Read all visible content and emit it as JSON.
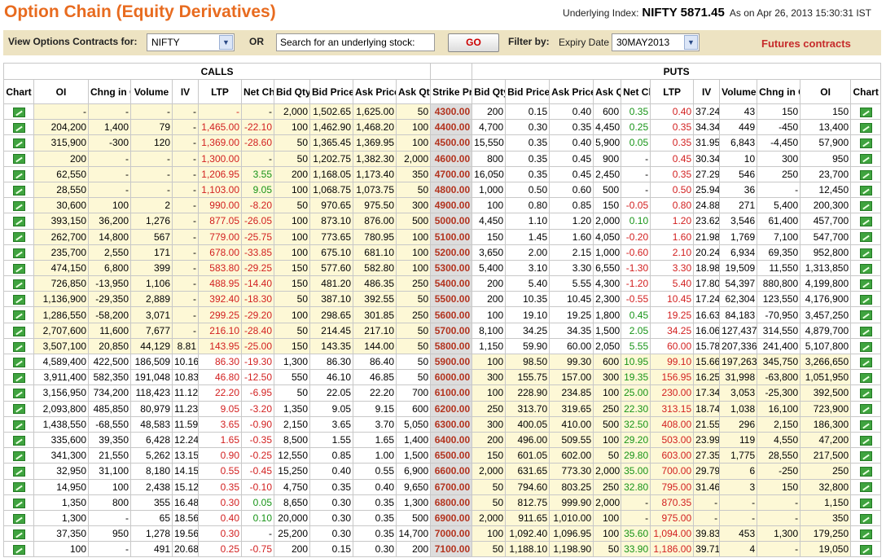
{
  "header": {
    "title": "Option Chain (Equity Derivatives)",
    "underlying_label": "Underlying Index:",
    "underlying_value": "NIFTY 5871.45",
    "as_on": "As on Apr 26, 2013 15:30:31 IST"
  },
  "filter": {
    "view_label": "View Options Contracts for:",
    "instrument": "NIFTY",
    "or_label": "OR",
    "search_value": "Search for an underlying stock:",
    "go_label": "GO",
    "filter_by_label": "Filter by:",
    "expiry_label": "Expiry Date",
    "expiry_value": "30MAY2013",
    "futures_link": "Futures contracts"
  },
  "table": {
    "calls_label": "CALLS",
    "puts_label": "PUTS",
    "columns": [
      "Chart",
      "OI",
      "Chng in OI",
      "Volume",
      "IV",
      "LTP",
      "Net Chng",
      "Bid Qty",
      "Bid Price",
      "Ask Price",
      "Ask Qty",
      "Strike Price",
      "Bid Qty",
      "Bid Price",
      "Ask Price",
      "Ask Qty",
      "Net Chng",
      "LTP",
      "IV",
      "Volume",
      "Chng in OI",
      "OI",
      "Chart"
    ],
    "rows": [
      [
        "",
        "-",
        "-",
        "-",
        "-",
        "-",
        "-",
        "2,000",
        "1,502.65",
        "1,625.00",
        "50",
        "4300.00",
        "200",
        "0.15",
        "0.40",
        "600",
        "0.35",
        "0.40",
        "37.24",
        "43",
        "150",
        "150",
        ""
      ],
      [
        "",
        "204,200",
        "1,400",
        "79",
        "-",
        "1,465.00",
        "-22.10",
        "100",
        "1,462.90",
        "1,468.20",
        "100",
        "4400.00",
        "4,700",
        "0.30",
        "0.35",
        "4,450",
        "0.25",
        "0.35",
        "34.34",
        "449",
        "-450",
        "13,400",
        ""
      ],
      [
        "",
        "315,900",
        "-300",
        "120",
        "-",
        "1,369.00",
        "-28.60",
        "50",
        "1,365.45",
        "1,369.95",
        "100",
        "4500.00",
        "15,550",
        "0.35",
        "0.40",
        "5,900",
        "0.05",
        "0.35",
        "31.95",
        "6,843",
        "-4,450",
        "57,900",
        ""
      ],
      [
        "",
        "200",
        "-",
        "-",
        "-",
        "1,300.00",
        "-",
        "50",
        "1,202.75",
        "1,382.30",
        "2,000",
        "4600.00",
        "800",
        "0.35",
        "0.45",
        "900",
        "-",
        "0.45",
        "30.34",
        "10",
        "300",
        "950",
        ""
      ],
      [
        "",
        "62,550",
        "-",
        "-",
        "-",
        "1,206.95",
        "3.55",
        "200",
        "1,168.05",
        "1,173.40",
        "350",
        "4700.00",
        "16,050",
        "0.35",
        "0.45",
        "2,450",
        "-",
        "0.35",
        "27.29",
        "546",
        "250",
        "23,700",
        ""
      ],
      [
        "",
        "28,550",
        "-",
        "-",
        "-",
        "1,103.00",
        "9.05",
        "100",
        "1,068.75",
        "1,073.75",
        "50",
        "4800.00",
        "1,000",
        "0.50",
        "0.60",
        "500",
        "-",
        "0.50",
        "25.94",
        "36",
        "-",
        "12,450",
        ""
      ],
      [
        "",
        "30,600",
        "100",
        "2",
        "-",
        "990.00",
        "-8.20",
        "50",
        "970.65",
        "975.50",
        "300",
        "4900.00",
        "100",
        "0.80",
        "0.85",
        "150",
        "-0.05",
        "0.80",
        "24.88",
        "271",
        "5,400",
        "200,300",
        ""
      ],
      [
        "",
        "393,150",
        "36,200",
        "1,276",
        "-",
        "877.05",
        "-26.05",
        "100",
        "873.10",
        "876.00",
        "500",
        "5000.00",
        "4,450",
        "1.10",
        "1.20",
        "2,000",
        "0.10",
        "1.20",
        "23.62",
        "3,546",
        "61,400",
        "457,700",
        ""
      ],
      [
        "",
        "262,700",
        "14,800",
        "567",
        "-",
        "779.00",
        "-25.75",
        "100",
        "773.65",
        "780.95",
        "100",
        "5100.00",
        "150",
        "1.45",
        "1.60",
        "4,050",
        "-0.20",
        "1.60",
        "21.98",
        "1,769",
        "7,100",
        "547,700",
        ""
      ],
      [
        "",
        "235,700",
        "2,550",
        "171",
        "-",
        "678.00",
        "-33.85",
        "100",
        "675.10",
        "681.10",
        "100",
        "5200.00",
        "3,650",
        "2.00",
        "2.15",
        "1,000",
        "-0.60",
        "2.10",
        "20.24",
        "6,934",
        "69,350",
        "952,800",
        ""
      ],
      [
        "",
        "474,150",
        "6,800",
        "399",
        "-",
        "583.80",
        "-29.25",
        "150",
        "577.60",
        "582.80",
        "100",
        "5300.00",
        "5,400",
        "3.10",
        "3.30",
        "6,550",
        "-1.30",
        "3.30",
        "18.98",
        "19,509",
        "11,550",
        "1,313,850",
        ""
      ],
      [
        "",
        "726,850",
        "-13,950",
        "1,106",
        "-",
        "488.95",
        "-14.40",
        "150",
        "481.20",
        "486.35",
        "250",
        "5400.00",
        "200",
        "5.40",
        "5.55",
        "4,300",
        "-1.20",
        "5.40",
        "17.80",
        "54,397",
        "880,800",
        "4,199,800",
        ""
      ],
      [
        "",
        "1,136,900",
        "-29,350",
        "2,889",
        "-",
        "392.40",
        "-18.30",
        "50",
        "387.10",
        "392.55",
        "50",
        "5500.00",
        "200",
        "10.35",
        "10.45",
        "2,300",
        "-0.55",
        "10.45",
        "17.24",
        "62,304",
        "123,550",
        "4,176,900",
        ""
      ],
      [
        "",
        "1,286,550",
        "-58,200",
        "3,071",
        "-",
        "299.25",
        "-29.20",
        "100",
        "298.65",
        "301.85",
        "250",
        "5600.00",
        "100",
        "19.10",
        "19.25",
        "1,800",
        "0.45",
        "19.25",
        "16.63",
        "84,183",
        "-70,950",
        "3,457,250",
        ""
      ],
      [
        "",
        "2,707,600",
        "11,600",
        "7,677",
        "-",
        "216.10",
        "-28.40",
        "50",
        "214.45",
        "217.10",
        "50",
        "5700.00",
        "8,100",
        "34.25",
        "34.35",
        "1,500",
        "2.05",
        "34.25",
        "16.06",
        "127,437",
        "314,550",
        "4,879,700",
        ""
      ],
      [
        "",
        "3,507,100",
        "20,850",
        "44,129",
        "8.81",
        "143.95",
        "-25.00",
        "150",
        "143.35",
        "144.00",
        "50",
        "5800.00",
        "1,150",
        "59.90",
        "60.00",
        "2,050",
        "5.55",
        "60.00",
        "15.78",
        "207,336",
        "241,400",
        "5,107,800",
        ""
      ],
      [
        "",
        "4,589,400",
        "422,500",
        "186,509",
        "10.16",
        "86.30",
        "-19.30",
        "1,300",
        "86.30",
        "86.40",
        "50",
        "5900.00",
        "100",
        "98.50",
        "99.30",
        "600",
        "10.95",
        "99.10",
        "15.66",
        "197,263",
        "345,750",
        "3,266,650",
        ""
      ],
      [
        "",
        "3,911,400",
        "582,350",
        "191,048",
        "10.83",
        "46.80",
        "-12.50",
        "550",
        "46.10",
        "46.85",
        "50",
        "6000.00",
        "300",
        "155.75",
        "157.00",
        "300",
        "19.35",
        "156.95",
        "16.25",
        "31,998",
        "-63,800",
        "1,051,950",
        ""
      ],
      [
        "",
        "3,156,950",
        "734,200",
        "118,423",
        "11.12",
        "22.20",
        "-6.95",
        "50",
        "22.05",
        "22.20",
        "700",
        "6100.00",
        "100",
        "228.90",
        "234.85",
        "100",
        "25.00",
        "230.00",
        "17.34",
        "3,053",
        "-25,300",
        "392,500",
        ""
      ],
      [
        "",
        "2,093,800",
        "485,850",
        "80,979",
        "11.23",
        "9.05",
        "-3.20",
        "1,350",
        "9.05",
        "9.15",
        "600",
        "6200.00",
        "250",
        "313.70",
        "319.65",
        "250",
        "22.30",
        "313.15",
        "18.74",
        "1,038",
        "16,100",
        "723,900",
        ""
      ],
      [
        "",
        "1,438,550",
        "-68,550",
        "48,583",
        "11.59",
        "3.65",
        "-0.90",
        "2,150",
        "3.65",
        "3.70",
        "5,050",
        "6300.00",
        "300",
        "400.05",
        "410.00",
        "500",
        "32.50",
        "408.00",
        "21.55",
        "296",
        "2,150",
        "186,300",
        ""
      ],
      [
        "",
        "335,600",
        "39,350",
        "6,428",
        "12.24",
        "1.65",
        "-0.35",
        "8,500",
        "1.55",
        "1.65",
        "1,400",
        "6400.00",
        "200",
        "496.00",
        "509.55",
        "100",
        "29.20",
        "503.00",
        "23.99",
        "119",
        "4,550",
        "47,200",
        ""
      ],
      [
        "",
        "341,300",
        "21,550",
        "5,262",
        "13.15",
        "0.90",
        "-0.25",
        "12,550",
        "0.85",
        "1.00",
        "1,500",
        "6500.00",
        "150",
        "601.05",
        "602.00",
        "50",
        "29.80",
        "603.00",
        "27.35",
        "1,775",
        "28,550",
        "217,500",
        ""
      ],
      [
        "",
        "32,950",
        "31,100",
        "8,180",
        "14.15",
        "0.55",
        "-0.45",
        "15,250",
        "0.40",
        "0.55",
        "6,900",
        "6600.00",
        "2,000",
        "631.65",
        "773.30",
        "2,000",
        "35.00",
        "700.00",
        "29.79",
        "6",
        "-250",
        "250",
        ""
      ],
      [
        "",
        "14,950",
        "100",
        "2,438",
        "15.12",
        "0.35",
        "-0.10",
        "4,750",
        "0.35",
        "0.40",
        "9,650",
        "6700.00",
        "50",
        "794.60",
        "803.25",
        "250",
        "32.80",
        "795.00",
        "31.46",
        "3",
        "150",
        "32,800",
        ""
      ],
      [
        "",
        "1,350",
        "800",
        "355",
        "16.48",
        "0.30",
        "0.05",
        "8,650",
        "0.30",
        "0.35",
        "1,300",
        "6800.00",
        "50",
        "812.75",
        "999.90",
        "2,000",
        "-",
        "870.35",
        "-",
        "-",
        "-",
        "1,150",
        ""
      ],
      [
        "",
        "1,300",
        "-",
        "65",
        "18.56",
        "0.40",
        "0.10",
        "20,000",
        "0.30",
        "0.35",
        "500",
        "6900.00",
        "2,000",
        "911.65",
        "1,010.00",
        "100",
        "-",
        "975.00",
        "-",
        "-",
        "-",
        "350",
        ""
      ],
      [
        "",
        "37,350",
        "950",
        "1,278",
        "19.56",
        "0.30",
        "-",
        "25,200",
        "0.30",
        "0.35",
        "14,700",
        "7000.00",
        "100",
        "1,092.40",
        "1,096.95",
        "100",
        "35.60",
        "1,094.00",
        "39.83",
        "453",
        "1,300",
        "179,250",
        ""
      ],
      [
        "",
        "100",
        "-",
        "491",
        "20.68",
        "0.25",
        "-0.75",
        "200",
        "0.15",
        "0.30",
        "200",
        "7100.00",
        "50",
        "1,188.10",
        "1,198.90",
        "50",
        "33.90",
        "1,186.00",
        "39.71",
        "4",
        "-",
        "19,050",
        ""
      ]
    ]
  }
}
